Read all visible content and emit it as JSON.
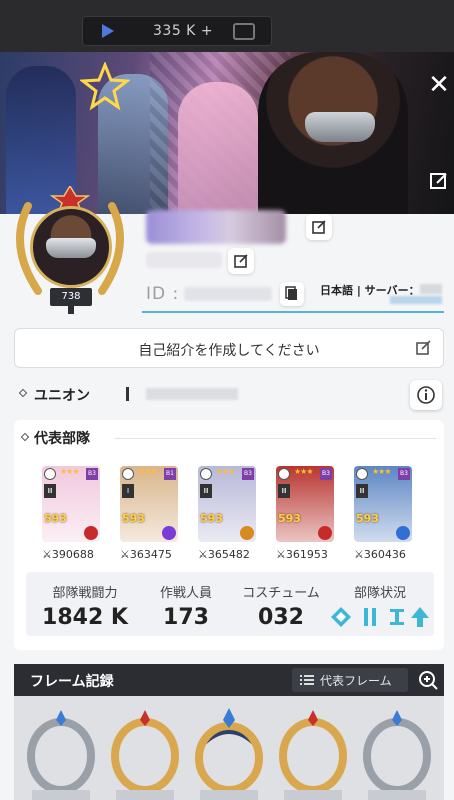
{
  "topbar": {
    "resource_value": "335 K",
    "add_symbol": "+"
  },
  "banner": {
    "close_symbol": "✕"
  },
  "profile": {
    "level": "738",
    "id_label": "ID :",
    "language_server": "日本語 | サーバー："
  },
  "intro": {
    "placeholder": "自己紹介を作成してください"
  },
  "union": {
    "label": "ユニオン"
  },
  "squad": {
    "title": "代表部隊",
    "members": [
      {
        "level": "593",
        "power": "390688",
        "code": "B3",
        "element_color": "#c72a2a",
        "bg": "#f1c8dd"
      },
      {
        "level": "593",
        "power": "363475",
        "code": "B1",
        "element_color": "#7a3bd6",
        "bg": "#d9b58b"
      },
      {
        "level": "593",
        "power": "365482",
        "code": "B3",
        "element_color": "#d98a1e",
        "bg": "#b8b8d8"
      },
      {
        "level": "593",
        "power": "361953",
        "code": "B3",
        "element_color": "#c72a2a",
        "bg": "#b8352f"
      },
      {
        "level": "593",
        "power": "360436",
        "code": "B3",
        "element_color": "#2f6fd6",
        "bg": "#5d86c4"
      }
    ],
    "stats": {
      "power_label": "部隊戦闘力",
      "power_value": "1842 K",
      "members_label": "作戦人員",
      "members_value": "173",
      "costume_label": "コスチューム",
      "costume_value": "032",
      "status_label": "部隊状況"
    }
  },
  "frames": {
    "title": "フレーム記録",
    "button_label": "代表フレーム"
  },
  "colors": {
    "accent": "#53b2de",
    "gold": "#d8b15c",
    "status_teal": "#3eb6d6"
  }
}
